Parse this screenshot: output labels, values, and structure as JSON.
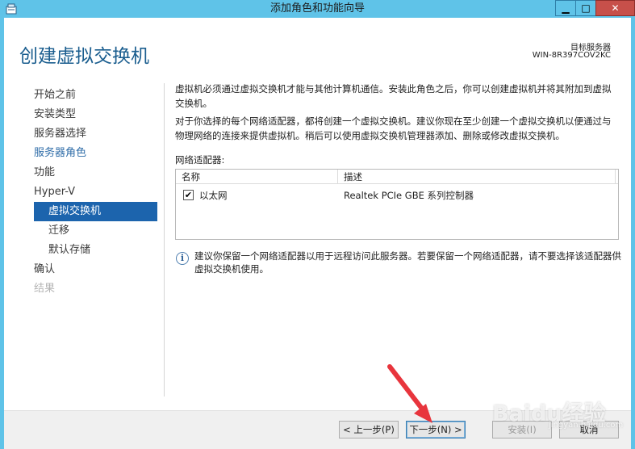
{
  "window": {
    "title": "添加角色和功能向导",
    "minimize_glyph": "▁",
    "maximize_glyph": "□",
    "close_glyph": "✕",
    "app_icon": "server-manager-icon"
  },
  "header": {
    "title": "创建虚拟交换机",
    "target_label": "目标服务器",
    "target_server": "WIN-8R397COV2KC"
  },
  "sidebar": {
    "items": [
      {
        "label": "开始之前"
      },
      {
        "label": "安装类型"
      },
      {
        "label": "服务器选择"
      },
      {
        "label": "服务器角色"
      },
      {
        "label": "功能"
      },
      {
        "label": "Hyper-V"
      },
      {
        "label": "虚拟交换机"
      },
      {
        "label": "迁移"
      },
      {
        "label": "默认存储"
      },
      {
        "label": "确认"
      },
      {
        "label": "结果"
      }
    ]
  },
  "content": {
    "para1": "虚拟机必须通过虚拟交换机才能与其他计算机通信。安装此角色之后，你可以创建虚拟机并将其附加到虚拟交换机。",
    "para2": "对于你选择的每个网络适配器，都将创建一个虚拟交换机。建议你现在至少创建一个虚拟交换机以便通过与物理网络的连接来提供虚拟机。稍后可以使用虚拟交换机管理器添加、删除或修改虚拟交换机。",
    "adapters_label": "网络适配器:",
    "table": {
      "columns": [
        "名称",
        "描述"
      ],
      "rows": [
        {
          "checked": true,
          "name": "以太网",
          "description": "Realtek PCIe GBE 系列控制器"
        }
      ]
    },
    "info_text": "建议你保留一个网络适配器以用于远程访问此服务器。若要保留一个网络适配器，请不要选择该适配器供虚拟交换机使用。",
    "info_icon": "info-icon"
  },
  "footer": {
    "prev_label": "< 上一步(P)",
    "next_label": "下一步(N) >",
    "install_label": "安装(I)",
    "cancel_label": "取消"
  },
  "colors": {
    "titlebar": "#5fc3e8",
    "accent": "#1c64ad",
    "title_text": "#1b5e8f",
    "arrow": "#e8353d"
  },
  "watermark": {
    "main": "Baidu经验",
    "sub": "jingyan.baidu.com"
  }
}
